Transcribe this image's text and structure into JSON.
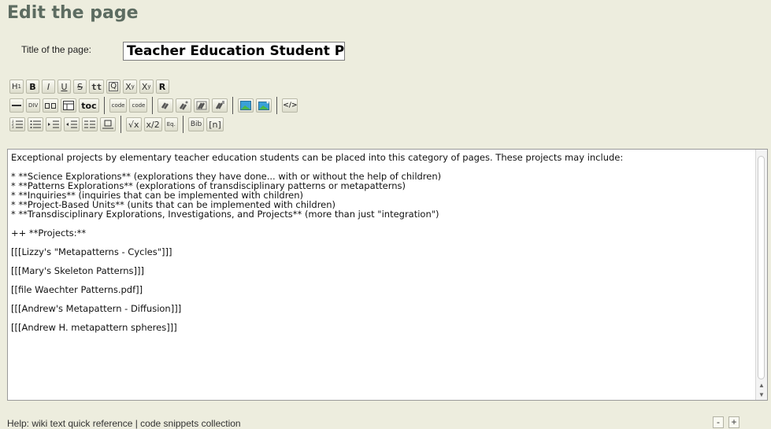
{
  "page_heading": "Edit the page",
  "title_field": {
    "label": "Title of the page:",
    "value": "Teacher Education Student Pro"
  },
  "toolbar": {
    "row1": [
      {
        "name": "heading-button",
        "label": "H1"
      },
      {
        "name": "bold-button",
        "label": "B"
      },
      {
        "name": "italic-button",
        "label": "I"
      },
      {
        "name": "underline-button",
        "label": "U"
      },
      {
        "name": "strikethrough-button",
        "label": "S"
      },
      {
        "name": "teletype-button",
        "label": "tt"
      },
      {
        "name": "quote-button",
        "label": "Q"
      },
      {
        "name": "superscript-button",
        "label": "Xy"
      },
      {
        "name": "subscript-button",
        "label": "Xy"
      },
      {
        "name": "raw-button",
        "label": "R"
      }
    ],
    "row2": {
      "rule": "—",
      "div": "DIV",
      "toc": "toc",
      "code": "code",
      "code2": "code"
    },
    "row3": {
      "sqrt": "√x",
      "frac": "x/2",
      "eq": "Eq.",
      "bib": "Bib",
      "fn": "[n]"
    }
  },
  "editor": {
    "content": "Exceptional projects by elementary teacher education students can be placed into this category of pages. These projects may include:\n\n* **Science Explorations** (explorations they have done... with or without the help of children)\n* **Patterns Explorations** (explorations of transdisciplinary patterns or metapatterns)\n* **Inquiries** (inquiries that can be implemented with children)\n* **Project-Based Units** (units that can be implemented with children)\n* **Transdisciplinary Explorations, Investigations, and Projects** (more than just \"integration\")\n\n++ **Projects:**\n\n[[[Lizzy's \"Metapatterns - Cycles\"]]]\n\n[[[Mary's Skeleton Patterns]]]\n\n[[file Waechter Patterns.pdf]]\n\n[[[Andrew's Metapattern - Diffusion]]]\n\n[[[Andrew H. metapattern spheres]]]"
  },
  "status": {
    "help_text": "Help: wiki text quick reference | code snippets collection",
    "shrink": "-",
    "grow": "+"
  },
  "colors": {
    "background": "#ededde",
    "heading": "#5d6c61",
    "image_icon": "#3aa0d8",
    "link_icon": "#555555"
  }
}
